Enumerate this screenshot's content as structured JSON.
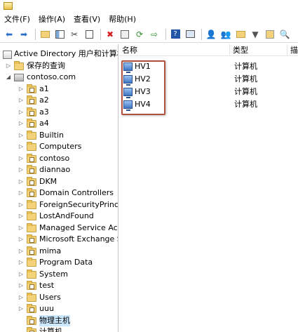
{
  "menu": [
    "文件(F)",
    "操作(A)",
    "查看(V)",
    "帮助(H)"
  ],
  "tree": [
    {
      "label": "Active Directory 用户和计算机",
      "expander": "",
      "icon": "ad-icon",
      "indent": 0
    },
    {
      "label": "保存的查询",
      "expander": "▷",
      "icon": "folder-icon",
      "indent": 1
    },
    {
      "label": "contoso.com",
      "expander": "◢",
      "icon": "domain-icon",
      "indent": 1
    },
    {
      "label": "a1",
      "expander": "▷",
      "icon": "ou-icon",
      "indent": 2
    },
    {
      "label": "a2",
      "expander": "▷",
      "icon": "ou-icon",
      "indent": 2
    },
    {
      "label": "a3",
      "expander": "▷",
      "icon": "ou-icon",
      "indent": 2
    },
    {
      "label": "a4",
      "expander": "▷",
      "icon": "ou-icon",
      "indent": 2
    },
    {
      "label": "Builtin",
      "expander": "▷",
      "icon": "folder-icon",
      "indent": 2
    },
    {
      "label": "Computers",
      "expander": "▷",
      "icon": "folder-icon",
      "indent": 2
    },
    {
      "label": "contoso",
      "expander": "▷",
      "icon": "ou-icon",
      "indent": 2
    },
    {
      "label": "diannao",
      "expander": "▷",
      "icon": "ou-icon",
      "indent": 2
    },
    {
      "label": "DKM",
      "expander": "▷",
      "icon": "ou-icon",
      "indent": 2
    },
    {
      "label": "Domain Controllers",
      "expander": "▷",
      "icon": "ou-icon",
      "indent": 2
    },
    {
      "label": "ForeignSecurityPrincipa",
      "expander": "▷",
      "icon": "folder-icon",
      "indent": 2
    },
    {
      "label": "LostAndFound",
      "expander": "▷",
      "icon": "folder-icon",
      "indent": 2
    },
    {
      "label": "Managed Service Acco",
      "expander": "▷",
      "icon": "folder-icon",
      "indent": 2
    },
    {
      "label": "Microsoft Exchange Se",
      "expander": "▷",
      "icon": "ou-icon",
      "indent": 2
    },
    {
      "label": "mima",
      "expander": "▷",
      "icon": "ou-icon",
      "indent": 2
    },
    {
      "label": "Program Data",
      "expander": "▷",
      "icon": "folder-icon",
      "indent": 2
    },
    {
      "label": "System",
      "expander": "▷",
      "icon": "folder-icon",
      "indent": 2
    },
    {
      "label": "test",
      "expander": "▷",
      "icon": "ou-icon",
      "indent": 2
    },
    {
      "label": "Users",
      "expander": "▷",
      "icon": "folder-icon",
      "indent": 2
    },
    {
      "label": "uuu",
      "expander": "▷",
      "icon": "ou-icon",
      "indent": 2
    },
    {
      "label": "物理主机",
      "expander": "",
      "icon": "ou-icon",
      "indent": 2,
      "selected": true
    },
    {
      "label": "计算机",
      "expander": "",
      "icon": "ou-icon",
      "indent": 2
    }
  ],
  "list": {
    "columns": [
      "名称",
      "类型",
      "描"
    ],
    "rows": [
      {
        "name": "HV1",
        "type": "计算机"
      },
      {
        "name": "HV2",
        "type": "计算机"
      },
      {
        "name": "HV3",
        "type": "计算机"
      },
      {
        "name": "HV4",
        "type": "计算机"
      }
    ]
  },
  "colors": {
    "highlight_box": "#b0503d",
    "selection": "#cce8ff",
    "folder": "#f4d27a"
  }
}
